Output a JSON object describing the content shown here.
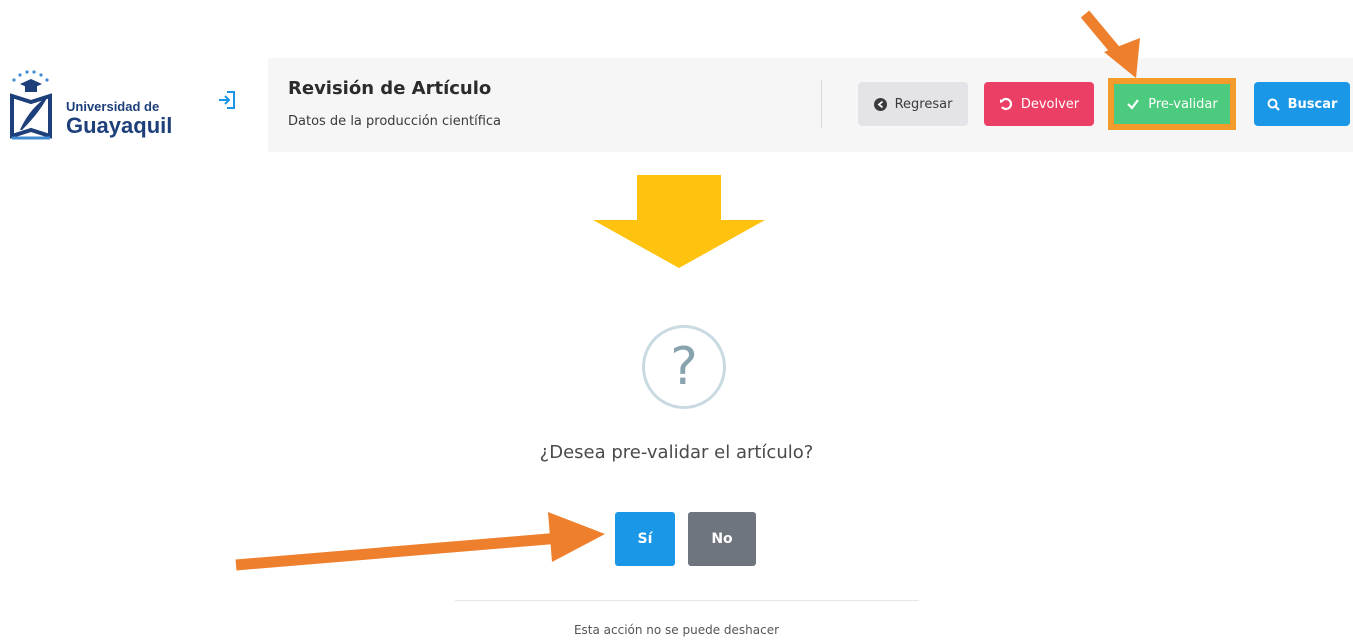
{
  "logo": {
    "line1": "Universidad de",
    "line2": "Guayaquil"
  },
  "header": {
    "title": "Revisión de Artículo",
    "subtitle": "Datos de la producción científica"
  },
  "toolbar": {
    "regresar_label": "Regresar",
    "devolver_label": "Devolver",
    "prevalidar_label": "Pre-validar",
    "buscar_label": "Buscar"
  },
  "dialog": {
    "icon_glyph": "?",
    "question": "¿Desea pre-validar el artículo?",
    "yes_label": "Sí",
    "no_label": "No",
    "footer_note": "Esta acción no se puede deshacer"
  },
  "colors": {
    "devolver": "#ec3f66",
    "prevalidar": "#4cca7d",
    "buscar": "#1a97e6",
    "highlight": "#f39b2b",
    "down_arrow": "#ffc20e",
    "pointer_arrows": "#ee7f2d"
  },
  "icons": [
    "login-icon",
    "circle-arrow-left-icon",
    "undo-icon",
    "check-icon",
    "search-icon",
    "question-icon"
  ]
}
